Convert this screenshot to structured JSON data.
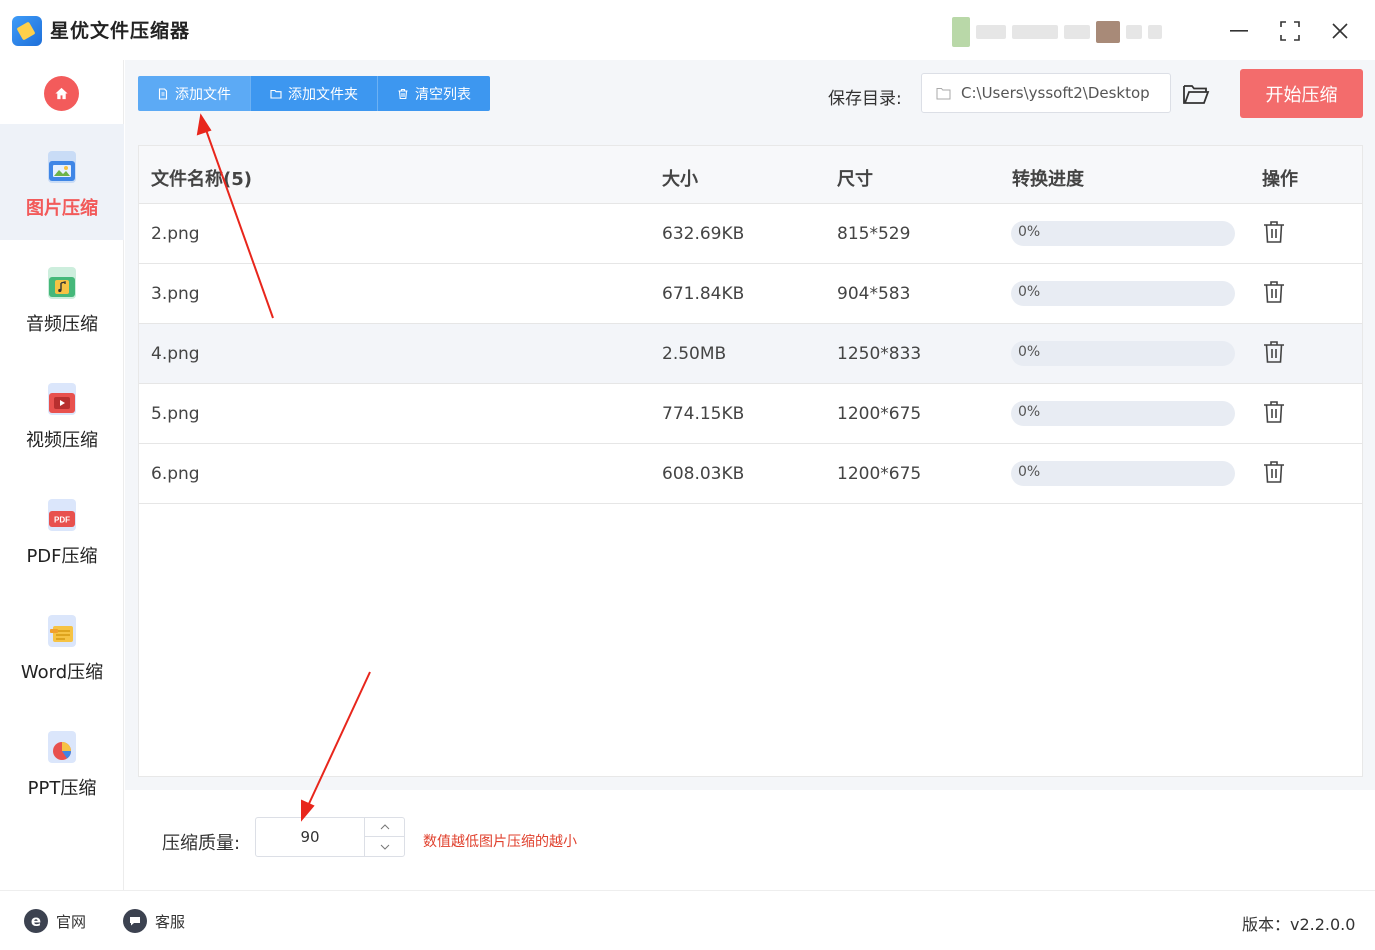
{
  "app": {
    "title": "星优文件压缩器",
    "window_controls": [
      "minimize",
      "maximize",
      "close"
    ]
  },
  "sidebar": {
    "home_icon": "home-icon",
    "items": [
      {
        "label": "图片压缩",
        "icon": "image-icon",
        "active": true
      },
      {
        "label": "音频压缩",
        "icon": "audio-icon",
        "active": false
      },
      {
        "label": "视频压缩",
        "icon": "video-icon",
        "active": false
      },
      {
        "label": "PDF压缩",
        "icon": "pdf-icon",
        "active": false
      },
      {
        "label": "Word压缩",
        "icon": "word-icon",
        "active": false
      },
      {
        "label": "PPT压缩",
        "icon": "ppt-icon",
        "active": false
      }
    ]
  },
  "toolbar": {
    "add_file": "添加文件",
    "add_folder": "添加文件夹",
    "clear_list": "清空列表",
    "save_label": "保存目录:",
    "save_path": "C:\\Users\\yssoft2\\Desktop",
    "start": "开始压缩"
  },
  "table": {
    "headers": {
      "name": "文件名称(5)",
      "size": "大小",
      "dims": "尺寸",
      "progress": "转换进度",
      "action": "操作"
    },
    "rows": [
      {
        "name": "2.png",
        "size": "632.69KB",
        "dims": "815*529",
        "progress": "0%",
        "progress_value": 0
      },
      {
        "name": "3.png",
        "size": "671.84KB",
        "dims": "904*583",
        "progress": "0%",
        "progress_value": 0
      },
      {
        "name": "4.png",
        "size": "2.50MB",
        "dims": "1250*833",
        "progress": "0%",
        "progress_value": 0
      },
      {
        "name": "5.png",
        "size": "774.15KB",
        "dims": "1200*675",
        "progress": "0%",
        "progress_value": 0
      },
      {
        "name": "6.png",
        "size": "608.03KB",
        "dims": "1200*675",
        "progress": "0%",
        "progress_value": 0
      }
    ]
  },
  "settings": {
    "quality_label": "压缩质量:",
    "quality_value": "90",
    "hint": "数值越低图片压缩的越小"
  },
  "footer": {
    "website": "官网",
    "support": "客服",
    "version": "版本：v2.2.0.0"
  },
  "colors": {
    "accent_blue": "#3d97f0",
    "start_red": "#f36c6c",
    "active_red": "#f25a5a",
    "hint_red": "#e0412e",
    "arrow_red": "#e8261c"
  }
}
